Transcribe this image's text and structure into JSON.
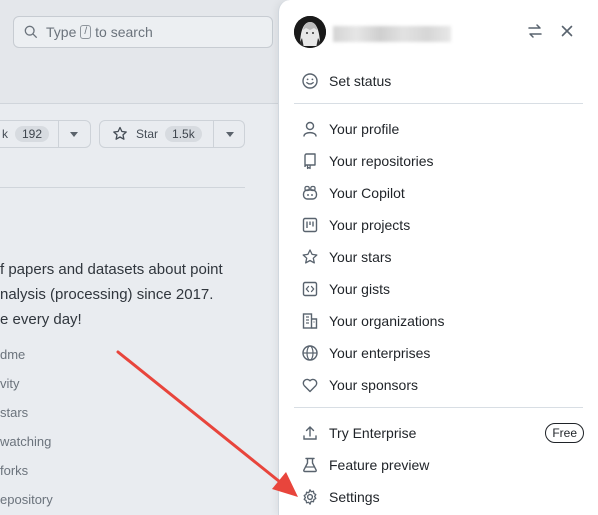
{
  "search": {
    "prefix": "Type",
    "key": "/",
    "suffix": "to search"
  },
  "repo_actions": {
    "fork_label_partial": "k",
    "fork_count": "192",
    "star_label": "Star",
    "star_count": "1.5k"
  },
  "about": {
    "lines": [
      "f papers and datasets about point",
      "nalysis (processing) since 2017.",
      "e every day!"
    ],
    "meta": [
      "dme",
      "vity",
      "stars",
      "watching",
      "forks",
      "epository"
    ]
  },
  "user_menu": {
    "set_status": "Set status",
    "items_group1": [
      {
        "label": "Your profile",
        "icon": "person-icon"
      },
      {
        "label": "Your repositories",
        "icon": "repo-icon"
      },
      {
        "label": "Your Copilot",
        "icon": "copilot-icon"
      },
      {
        "label": "Your projects",
        "icon": "project-icon"
      },
      {
        "label": "Your stars",
        "icon": "star-icon"
      },
      {
        "label": "Your gists",
        "icon": "code-square-icon"
      },
      {
        "label": "Your organizations",
        "icon": "organization-icon"
      },
      {
        "label": "Your enterprises",
        "icon": "globe-icon"
      },
      {
        "label": "Your sponsors",
        "icon": "heart-icon"
      }
    ],
    "items_group2": [
      {
        "label": "Try Enterprise",
        "icon": "upload-icon",
        "badge": "Free"
      },
      {
        "label": "Feature preview",
        "icon": "beaker-icon"
      },
      {
        "label": "Settings",
        "icon": "gear-icon"
      }
    ]
  },
  "colors": {
    "annotation_arrow": "#e8453c",
    "text": "#1f2328",
    "muted": "#6b737c"
  }
}
